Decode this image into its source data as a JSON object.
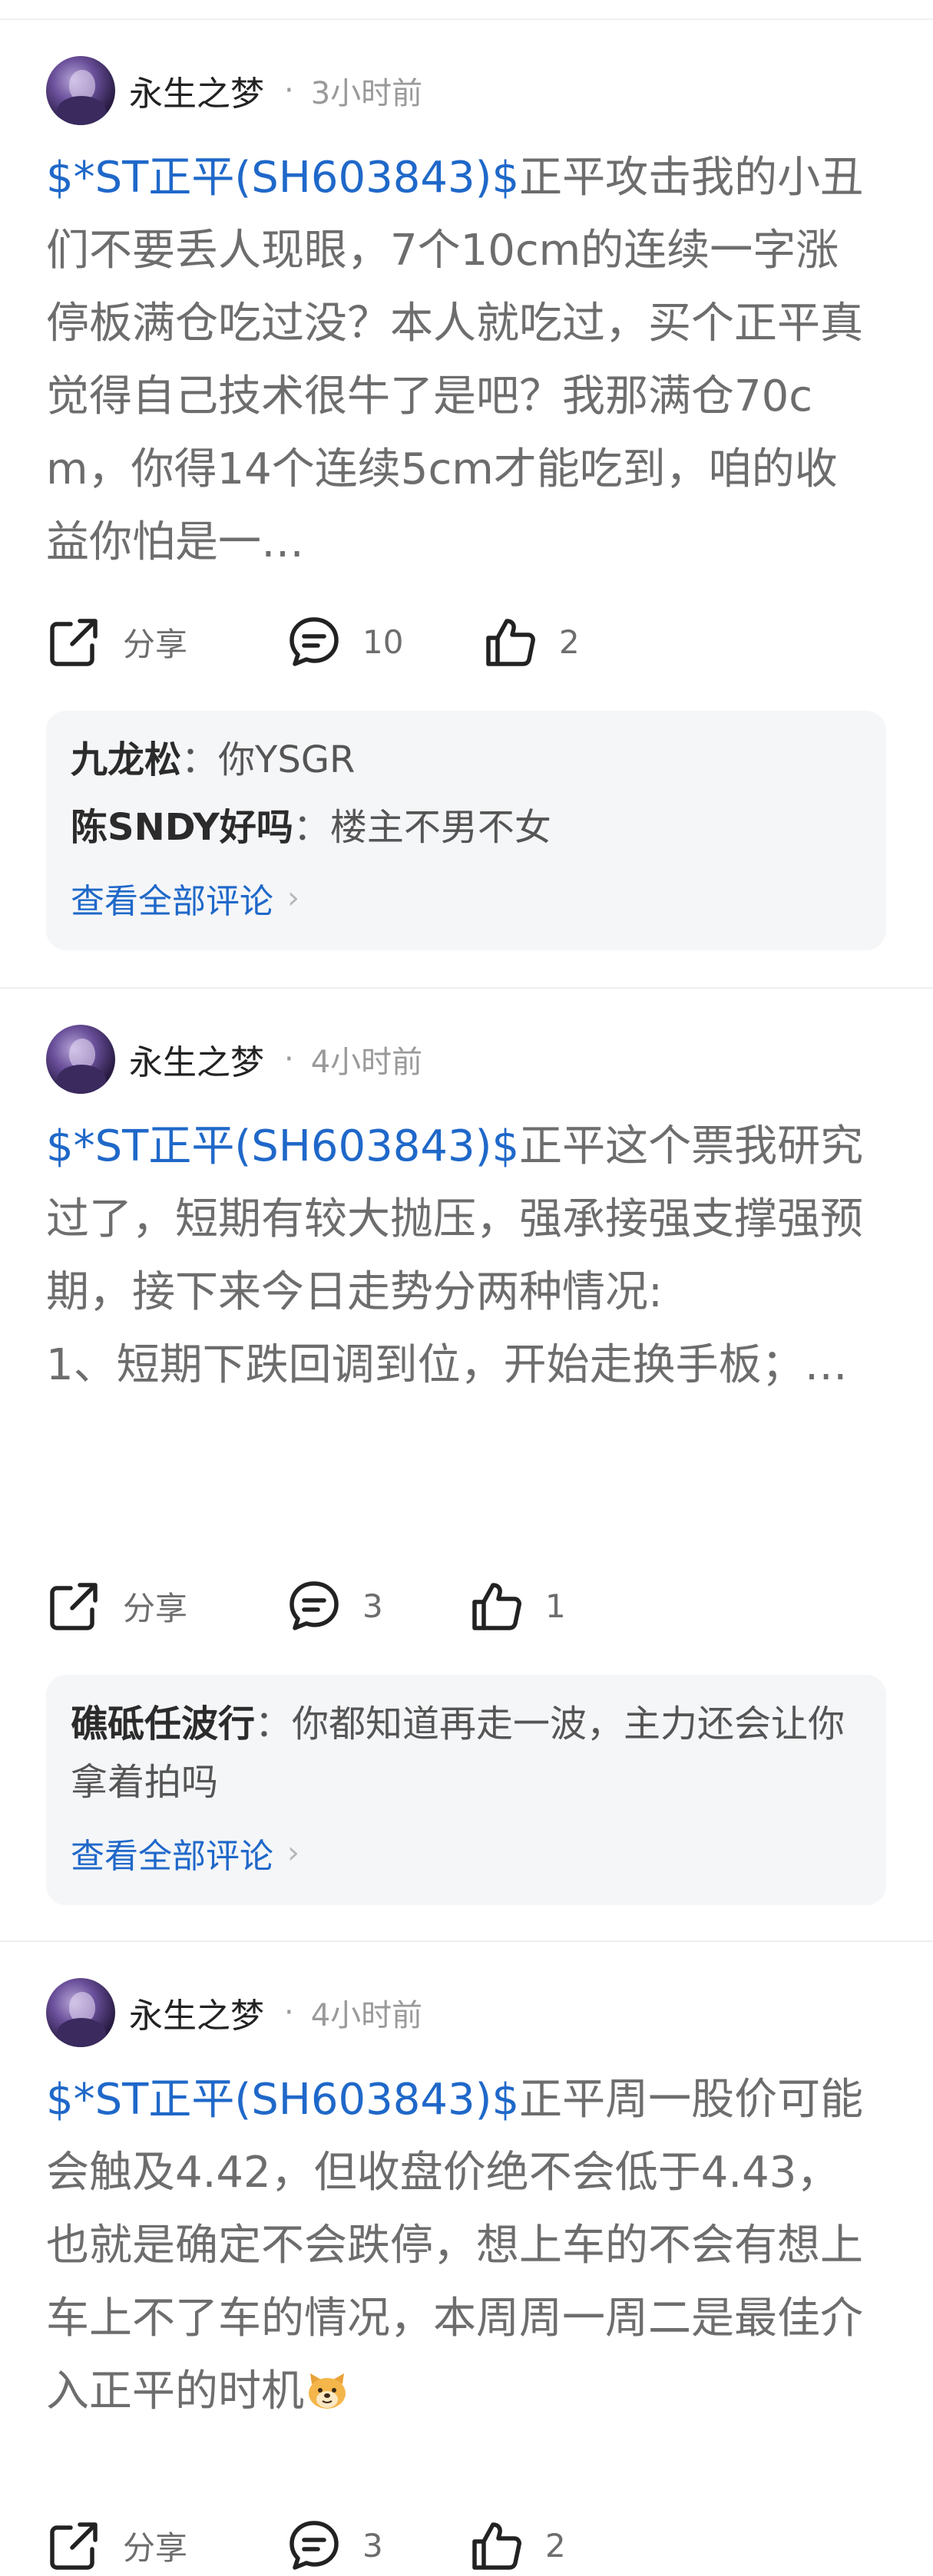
{
  "posts": [
    {
      "username": "永生之梦",
      "dot": "·",
      "time": "3小时前",
      "stock": "$*ST正平(SH603843)$",
      "text": "正平攻击我的小丑们不要丢人现眼，7个10cm的连续一字涨停板满仓吃过没？本人就吃过，买个正平真觉得自己技术很牛了是吧？我那满仓70cm，你得14个连续5cm才能吃到，咱的收益你怕是一…",
      "share_label": "分享",
      "comment_count": "10",
      "like_count": "2",
      "comments": [
        {
          "author": "九龙松",
          "separator": "：",
          "text": "你YSGR"
        },
        {
          "author": "陈SNDY好吗",
          "separator": "：",
          "text": "楼主不男不女"
        }
      ],
      "view_all": "查看全部评论",
      "chevron": "›"
    },
    {
      "username": "永生之梦",
      "dot": "·",
      "time": "4小时前",
      "stock": "$*ST正平(SH603843)$",
      "text": "正平这个票我研究过了，短期有较大抛压，强承接强支撑强预期，接下来今日走势分两种情况:",
      "text2": "1、短期下跌回调到位，开始走换手板；…",
      "share_label": "分享",
      "comment_count": "3",
      "like_count": "1",
      "comments": [
        {
          "author": "礁砥任波行",
          "separator": "：",
          "text": "你都知道再走一波，主力还会让你拿着拍吗"
        }
      ],
      "view_all": "查看全部评论",
      "chevron": "›"
    },
    {
      "username": "永生之梦",
      "dot": "·",
      "time": "4小时前",
      "stock": "$*ST正平(SH603843)$",
      "text": "正平周一股价可能会触及4.42，但收盘价绝不会低于4.43，也就是确定不会跌停，想上车的不会有想上车上不了车的情况，本周周一周二是最佳介入正平的时机",
      "emoji": "dog-face-emoji",
      "share_label": "分享",
      "comment_count": "3",
      "like_count": "2"
    }
  ],
  "colors": {
    "link": "#1f68c9",
    "text_gray": "#6d6d6d",
    "comment_bg": "#f5f6f8"
  },
  "icons": {
    "share": "share-icon",
    "comment": "comment-bubble-icon",
    "like": "thumbs-up-icon"
  }
}
